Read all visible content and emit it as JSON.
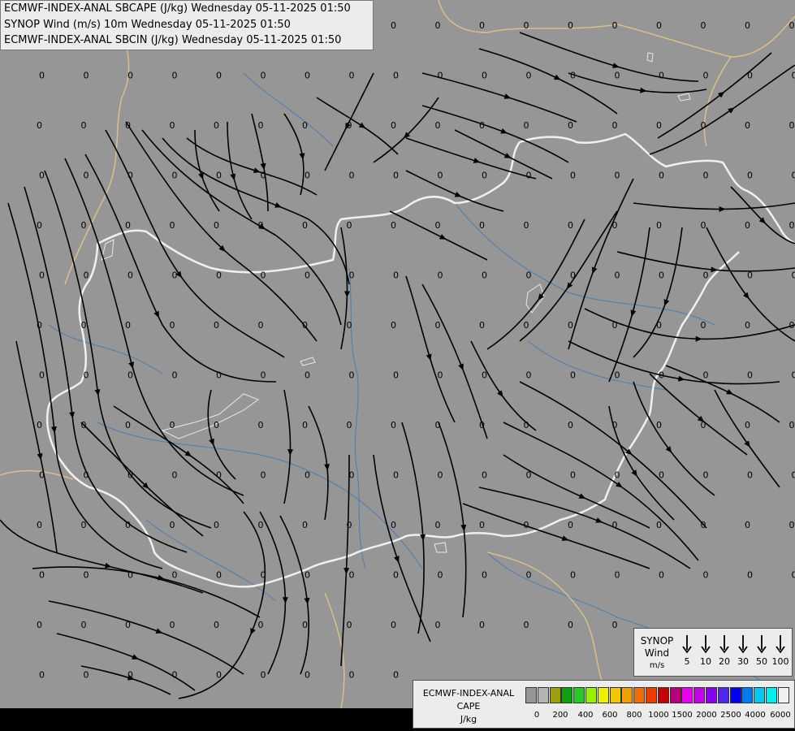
{
  "header": {
    "line1": "ECMWF-INDEX-ANAL SBCAPE (J/kg) Wednesday 05-11-2025 01:50",
    "line2": "SYNOP Wind (m/s) 10m Wednesday 05-11-2025 01:50",
    "line3": "ECMWF-INDEX-ANAL SBCIN (J/kg) Wednesday 05-11-2025 01:50"
  },
  "map": {
    "value_label": "0",
    "background_color": "#969696",
    "border_color": "#f0f0f0",
    "river_color": "#4d7cae",
    "neighbor_border_color": "#d8c08c",
    "streamline_color": "#000000"
  },
  "wind_legend": {
    "title": "SYNOP",
    "title2": "Wind",
    "unit": "m/s",
    "speeds": [
      "5",
      "10",
      "20",
      "30",
      "50",
      "100"
    ]
  },
  "cape_legend": {
    "title": "ECMWF-INDEX-ANAL",
    "title2": "CAPE",
    "unit": "J/kg",
    "ticks": [
      "0",
      "200",
      "400",
      "600",
      "800",
      "1000",
      "1500",
      "2000",
      "2500",
      "4000",
      "6000"
    ],
    "colors": [
      "#969696",
      "#b4b4b4",
      "#9e9e10",
      "#10a010",
      "#28c828",
      "#96f000",
      "#f0f000",
      "#f0c800",
      "#f0a000",
      "#f06e00",
      "#f03c00",
      "#c80000",
      "#b40078",
      "#f000f0",
      "#c800f0",
      "#8c00f0",
      "#5028f0",
      "#0000f0",
      "#0078f0",
      "#00c8f0",
      "#00f0f0",
      "#f0f0f0"
    ]
  }
}
